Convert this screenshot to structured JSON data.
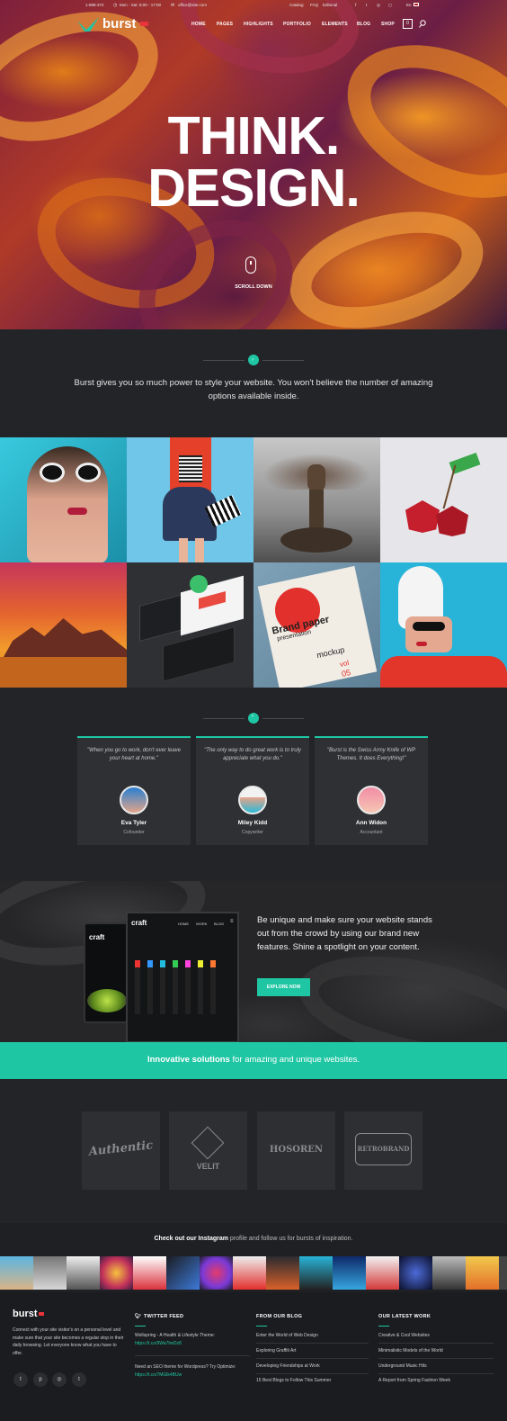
{
  "topbar": {
    "phone": "1-888-372",
    "hours": "Mon - Sat: 8:00 - 17:00",
    "email": "office@site.com",
    "links": [
      "Catalog",
      "FAQ",
      "Editorial"
    ],
    "lang": "En"
  },
  "nav": {
    "logo": "burst",
    "items": [
      "HOME",
      "PAGES",
      "HIGHLIGHTS",
      "PORTFOLIO",
      "ELEMENTS",
      "BLOG",
      "SHOP"
    ],
    "cart_count": "0"
  },
  "hero": {
    "line1": "THINK.",
    "line2": "DESIGN.",
    "scroll_label": "SCROLL DOWN"
  },
  "intro": {
    "text": "Burst gives you so much power to style your website. You won't believe the number of amazing options available inside."
  },
  "gallery": {
    "tiles": [
      "woman-sunglasses",
      "red-vest-outfit",
      "eagle-tree",
      "low-poly-cherries",
      "desert-mountains",
      "app-screens-mockup",
      "brand-paper-mockup",
      "white-beanie-woman"
    ],
    "mockup_lines": [
      "Brand paper",
      "presentation",
      "mockup",
      "vol",
      "05"
    ]
  },
  "testimonials": [
    {
      "quote": "\"When you go to work, don't ever leave your heart at home.\"",
      "name": "Eva Tyler",
      "role": "Cofounder"
    },
    {
      "quote": "\"The only way to do great work is to truly appreciate what you do.\"",
      "name": "Miley Kidd",
      "role": "Copywriter"
    },
    {
      "quote": "\"Burst is the Swiss Army Knife of WP Themes. It does Everything!\"",
      "name": "Ann Widon",
      "role": "Accountant"
    }
  ],
  "promo": {
    "text": "Be unique and make sure your website stands out from the crowd by using our brand new features. Shine a spotlight on your content.",
    "button": "EXPLORE NOW",
    "screen_logo": "craft",
    "screen_nav": [
      "HOME",
      "WORK",
      "BLOG"
    ],
    "phone_logo": "craft"
  },
  "band": {
    "bold": "Innovative solutions",
    "rest": " for amazing and unique websites."
  },
  "clients": [
    "Authentic",
    "VELIT",
    "HOSOREN",
    "RETROBRAND"
  ],
  "instagram": {
    "bold": "Check out our Instagram",
    "rest": " profile and follow us for bursts of inspiration."
  },
  "footer": {
    "logo": "burst",
    "about": "Connect with your site visitor's on a personal level and make sure that your site becomes a regular stop in their daily browsing. Let everyone know what you have to offer.",
    "twitter_head": "TWITTER FEED",
    "tweets": [
      {
        "text": "Wellspring - A Health & Lifestyle Theme: ",
        "link": "https://t.co/9Wa7heDz8"
      },
      {
        "text": "Need an SEO theme for Wordpress? Try Optimize: ",
        "link": "https://t.co/7MGlk4BUw"
      }
    ],
    "blog_head": "FROM OUR BLOG",
    "blog": [
      "Enter the World of Web Design",
      "Exploring Graffiti Art",
      "Developing Friendships at Work",
      "15 Best Blogs to Follow This Summer"
    ],
    "work_head": "OUR LATEST WORK",
    "work": [
      "Creative & Cool Websites",
      "Minimalistic Models of the World",
      "Underground Music Hits",
      "A Report from Spring Fashion Week"
    ]
  },
  "colors": {
    "accent": "#1fc6a3",
    "dark": "#232427",
    "footer": "#1b1c1f"
  }
}
